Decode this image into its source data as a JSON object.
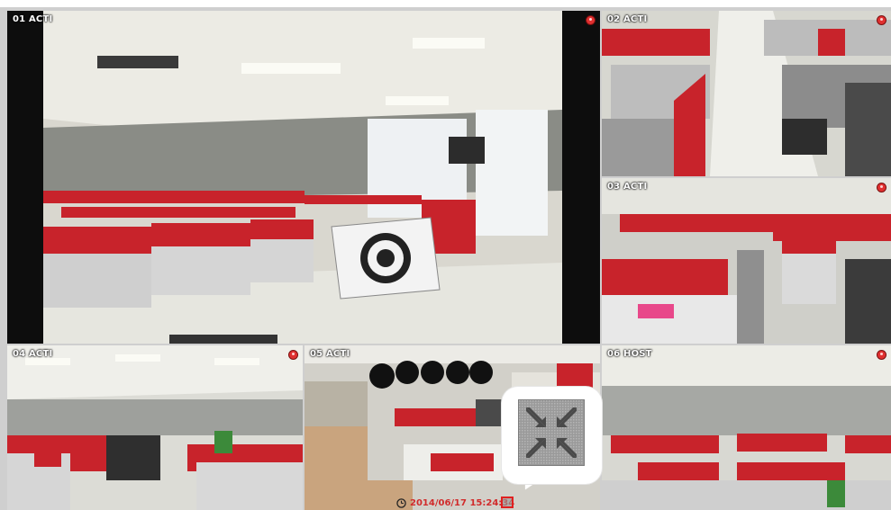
{
  "cameras": [
    {
      "id": "cam-1",
      "label": "01 ACTI",
      "recording": true
    },
    {
      "id": "cam-2",
      "label": "02 ACTI",
      "recording": true
    },
    {
      "id": "cam-3",
      "label": "03 ACTI",
      "recording": true
    },
    {
      "id": "cam-4",
      "label": "04 ACTI",
      "recording": true
    },
    {
      "id": "cam-5",
      "label": "05 ACTI",
      "recording": true
    },
    {
      "id": "cam-6",
      "label": "06 HOST",
      "recording": true
    }
  ],
  "playback": {
    "timestamp": "2014/06/17 15:24:34"
  },
  "icons": {
    "clock": "clock-icon",
    "zoom": "fit-screen-icon",
    "recording": "recording-dot-icon"
  },
  "colors": {
    "partition_red": "#c8232b",
    "timestamp": "#d12b2b",
    "highlight": "#e02020"
  }
}
